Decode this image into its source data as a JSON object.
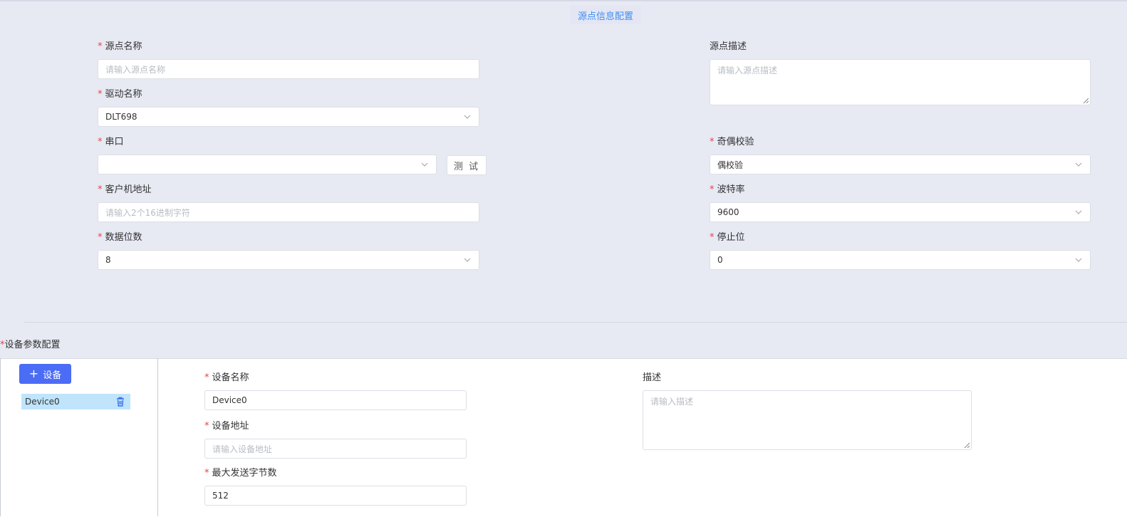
{
  "source_config": {
    "title": "源点信息配置",
    "name_label": "源点名称",
    "name_placeholder": "请输入源点名称",
    "desc_label": "源点描述",
    "desc_placeholder": "请输入源点描述",
    "driver_label": "驱动名称",
    "driver_value": "DLT698",
    "serial_label": "串口",
    "serial_value": "",
    "test_button": "测 试",
    "parity_label": "奇偶校验",
    "parity_value": "偶校验",
    "client_addr_label": "客户机地址",
    "client_addr_placeholder": "请输入2个16进制字符",
    "baud_label": "波特率",
    "baud_value": "9600",
    "databits_label": "数据位数",
    "databits_value": "8",
    "stopbits_label": "停止位",
    "stopbits_value": "0"
  },
  "device_config": {
    "title": "设备参数配置",
    "add_button": "设备",
    "devices": [
      {
        "name": "Device0"
      }
    ],
    "device_name_label": "设备名称",
    "device_name_value": "Device0",
    "device_addr_label": "设备地址",
    "device_addr_placeholder": "请输入设备地址",
    "max_bytes_label": "最大发送字节数",
    "max_bytes_value": "512",
    "desc_label": "描述",
    "desc_placeholder": "请输入描述"
  },
  "required_mark": "*",
  "icons": {
    "add": "plus-icon",
    "delete": "trash-icon",
    "dropdown": "chevron-down-icon"
  },
  "colors": {
    "accent": "#4b6cf5",
    "title": "#3f8ff0",
    "required": "#e54545",
    "selected": "#bfe4fb"
  }
}
